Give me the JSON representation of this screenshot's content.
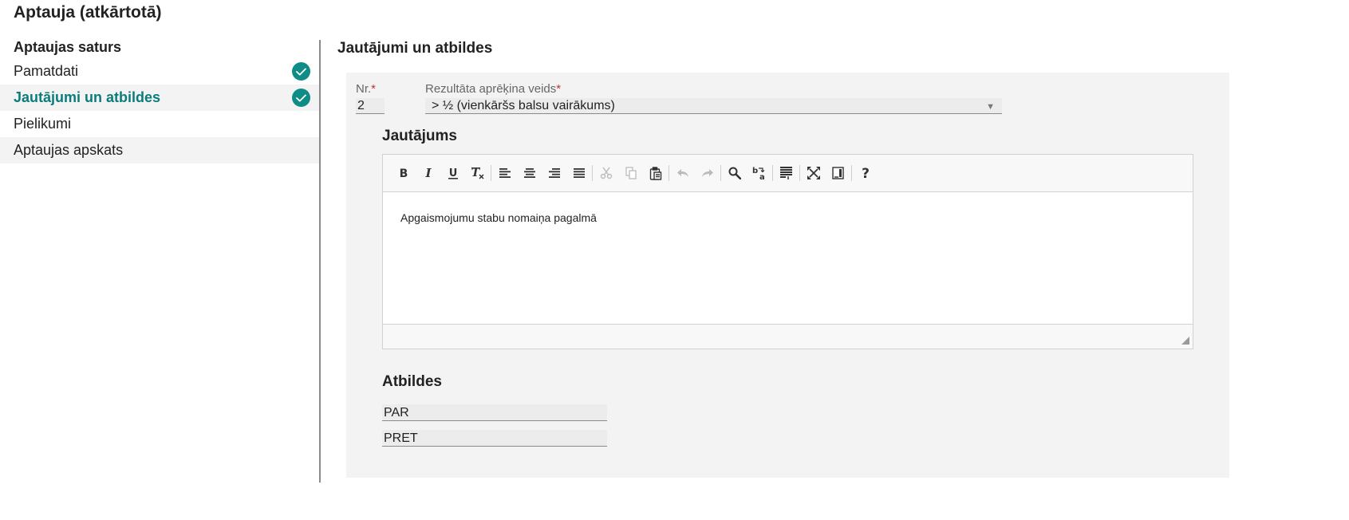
{
  "page": {
    "title": "Aptauja (atkārtotā)"
  },
  "sidebar": {
    "heading": "Aptaujas saturs",
    "items": [
      {
        "label": "Pamatdati",
        "completed": true,
        "active": false
      },
      {
        "label": "Jautājumi un atbildes",
        "completed": true,
        "active": true
      },
      {
        "label": "Pielikumi",
        "completed": false,
        "active": false
      },
      {
        "label": "Aptaujas apskats",
        "completed": false,
        "active": false
      }
    ]
  },
  "main": {
    "section_title": "Jautājumi un atbildes",
    "nr": {
      "label": "Nr.",
      "required_mark": "*",
      "value": "2"
    },
    "calc_type": {
      "label": "Rezultāta aprēķina veids",
      "required_mark": "*",
      "value": "> ½ (vienkāršs balsu vairākums)"
    },
    "question": {
      "heading": "Jautājums",
      "content": "Apgaismojumu stabu nomaiņa pagalmā",
      "toolbar_icons": [
        "bold-icon",
        "italic-icon",
        "underline-icon",
        "remove-format-icon",
        "align-left-icon",
        "align-center-icon",
        "align-right-icon",
        "justify-icon",
        "cut-icon",
        "copy-icon",
        "paste-icon",
        "undo-icon",
        "redo-icon",
        "find-icon",
        "replace-icon",
        "show-blocks-icon",
        "maximize-icon",
        "preview-icon",
        "help-icon"
      ]
    },
    "answers": {
      "heading": "Atbildes",
      "items": [
        "PAR",
        "PRET"
      ]
    }
  },
  "colors": {
    "accent": "#0b7b7b",
    "check": "#0f8c86",
    "required": "#c0392b"
  }
}
